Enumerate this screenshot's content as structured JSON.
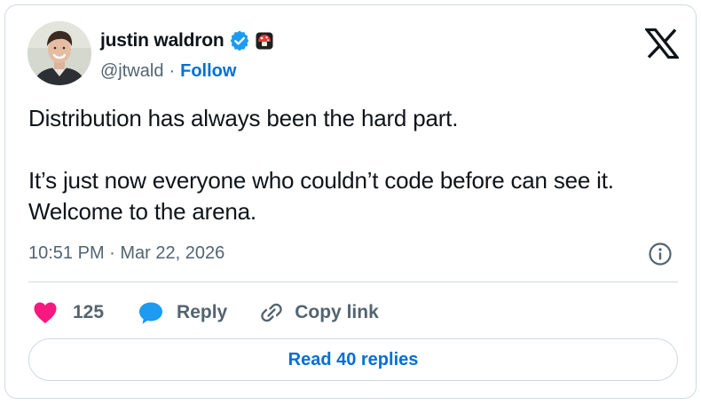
{
  "author": {
    "name": "justin waldron",
    "handle": "@jtwald",
    "separator": "·",
    "follow_label": "Follow",
    "avatar_icon": "profile-photo",
    "verified_icon": "verified-badge-icon",
    "emoji_icon": "mushroom-icon"
  },
  "brand": {
    "logo_icon": "x-logo-icon"
  },
  "tweet": {
    "paragraphs": [
      "Distribution has always been the hard part.",
      "It’s just now everyone who couldn’t code before can see it. Welcome to the arena."
    ],
    "timestamp": "10:51 PM · Mar 22, 2026",
    "info_icon": "info-icon"
  },
  "actions": {
    "like_count": "125",
    "reply_label": "Reply",
    "copy_link_label": "Copy link"
  },
  "footer": {
    "read_replies_label": "Read 40 replies"
  },
  "colors": {
    "link_blue": "#006fd6",
    "verified_blue": "#1d9bf0",
    "like_pink": "#f91880",
    "reply_blue": "#1d9bf0",
    "muted_text": "#536471",
    "border": "#cfd9de",
    "text": "#0f1419"
  }
}
